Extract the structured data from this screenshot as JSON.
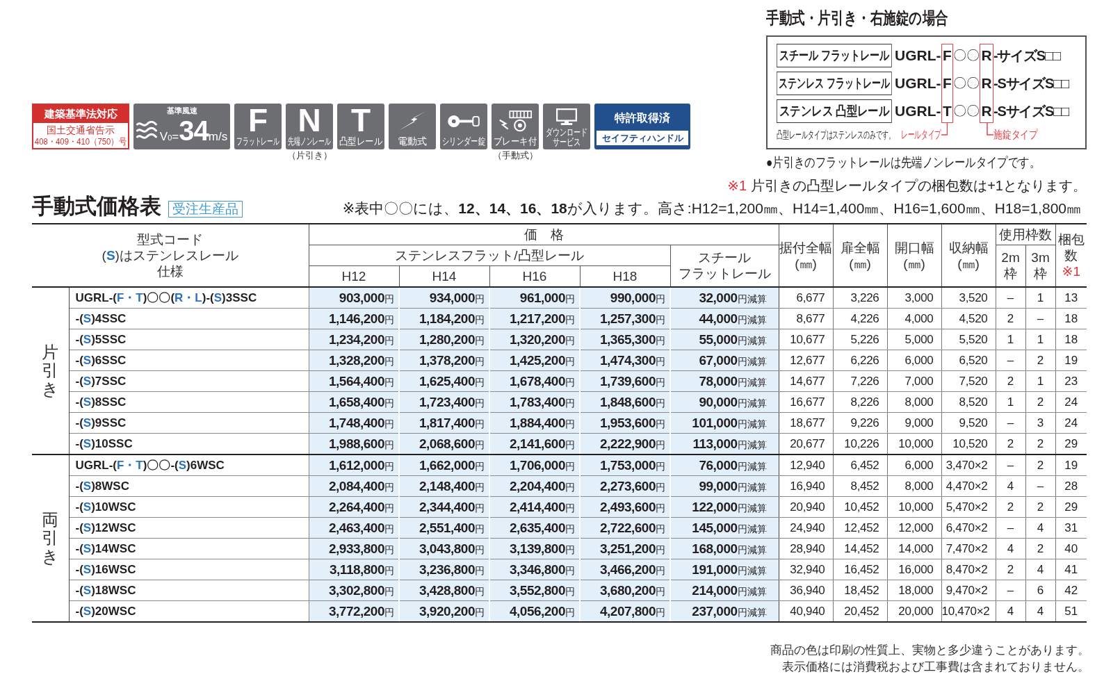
{
  "badges": [
    {
      "kind": "certification",
      "title": "建築基準法対応",
      "lines": [
        "国土交通省告示",
        "408・409・410（750）号"
      ]
    },
    {
      "kind": "wind",
      "caption": "基準風速",
      "speed": "V$_{0}$=**34**m/s"
    },
    {
      "kind": "letter",
      "letter": "F",
      "label": "フラットレール"
    },
    {
      "kind": "letter",
      "letter": "N",
      "label": "先端ノンレール",
      "note": "（片引き）"
    },
    {
      "kind": "letter",
      "letter": "T",
      "label": "凸型レール"
    },
    {
      "kind": "electric",
      "label": "電動式"
    },
    {
      "kind": "lock",
      "label": "シリンダー錠"
    },
    {
      "kind": "brake",
      "label": "ブレーキ付",
      "note": "（手動式）"
    },
    {
      "kind": "download",
      "label": "ダウンロードサービス"
    },
    {
      "kind": "patent",
      "title": "特許取得済",
      "subtitle": "セイフティハンドル"
    }
  ],
  "code_guide": {
    "title": "手動式・片引き・右施錠の場合",
    "rows": [
      {
        "label": "スチール フラットレール",
        "prefix": "UGRL-",
        "rail": "F",
        "size": "〇〇",
        "lock": "R",
        "suffix": "-サイズS□□"
      },
      {
        "label": "ステンレス フラットレール",
        "prefix": "UGRL-",
        "rail": "F",
        "size": "〇〇",
        "lock": "R",
        "suffix": "-SサイズS□□"
      },
      {
        "label": "ステンレス 凸型レール",
        "prefix": "UGRL-",
        "rail": "T",
        "size": "〇〇",
        "lock": "R",
        "suffix": "-SサイズS□□"
      }
    ],
    "note": "凸型レールタイプはステンレスのみです。",
    "rail_marker": "レールタイプ",
    "lock_marker": "施錠タイプ",
    "bullet": "●片引きのフラットレールは先端ノンレールタイプです。"
  },
  "package_note": {
    "mark": "※1",
    "text": "片引きの凸型レールタイプの梱包数は+1となります。"
  },
  "heading": {
    "title": "手動式価格表",
    "tag": "受注生産品",
    "note": "※表中〇〇には、**12、14、16、18**が入ります。高さ:H12=1,200㎜、H14=1,400㎜、H16=1,600㎜、H18=1,800㎜"
  },
  "table": {
    "code_header": [
      [
        {
          "text": "型式コード",
          "emphasis": false
        }
      ],
      [
        {
          "text": "(",
          "emphasis": false
        },
        {
          "text": "S",
          "emphasis": true
        },
        {
          "text": ")はステンレスレール",
          "emphasis": false
        }
      ],
      [
        {
          "text": "仕様",
          "emphasis": false
        }
      ]
    ],
    "price_header": "価　格",
    "stainless_header": "ステンレスフラット/凸型レール",
    "height_headers": [
      "H12",
      "H14",
      "H16",
      "H18"
    ],
    "steel_header": [
      "スチール",
      "フラットレール"
    ],
    "size_headers": [
      "据付全幅(㎜)",
      "扉全幅(㎜)",
      "開口幅(㎜)",
      "収納幅(㎜)"
    ],
    "frames_header": "使用枠数",
    "frame_headers": [
      "2m枠",
      "3m枠"
    ],
    "packages_header": {
      "label": "梱包数",
      "note": "※1"
    },
    "groups": [
      {
        "label": "片引き",
        "rows": [
          {
            "code": [
              {
                "text": "UGRL-(",
                "emphasis": false
              },
              {
                "text": "F・T",
                "emphasis": true
              },
              {
                "text": ")〇〇(",
                "emphasis": false
              },
              {
                "text": "R・L",
                "emphasis": true
              },
              {
                "text": ")-(",
                "emphasis": false
              },
              {
                "text": "S",
                "emphasis": true
              },
              {
                "text": ")3SSC",
                "emphasis": false
              }
            ],
            "prices": [
              "903,000円",
              "934,000円",
              "961,000円",
              "990,000円"
            ],
            "steel": "32,000円減算",
            "sizes": [
              "6,677",
              "3,226",
              "3,000",
              "3,520"
            ],
            "frames": [
              "–",
              "1"
            ],
            "packages": "13"
          },
          {
            "code": [
              {
                "text": "-(",
                "emphasis": false
              },
              {
                "text": "S",
                "emphasis": true
              },
              {
                "text": ")4SSC",
                "emphasis": false
              }
            ],
            "prices": [
              "1,146,200円",
              "1,184,200円",
              "1,217,200円",
              "1,257,300円"
            ],
            "steel": "44,000円減算",
            "sizes": [
              "8,677",
              "4,226",
              "4,000",
              "4,520"
            ],
            "frames": [
              "2",
              "–"
            ],
            "packages": "18"
          },
          {
            "code": [
              {
                "text": "-(",
                "emphasis": false
              },
              {
                "text": "S",
                "emphasis": true
              },
              {
                "text": ")5SSC",
                "emphasis": false
              }
            ],
            "prices": [
              "1,234,200円",
              "1,280,200円",
              "1,320,200円",
              "1,365,300円"
            ],
            "steel": "55,000円減算",
            "sizes": [
              "10,677",
              "5,226",
              "5,000",
              "5,520"
            ],
            "frames": [
              "1",
              "1"
            ],
            "packages": "18"
          },
          {
            "code": [
              {
                "text": "-(",
                "emphasis": false
              },
              {
                "text": "S",
                "emphasis": true
              },
              {
                "text": ")6SSC",
                "emphasis": false
              }
            ],
            "prices": [
              "1,328,200円",
              "1,378,200円",
              "1,425,200円",
              "1,474,300円"
            ],
            "steel": "67,000円減算",
            "sizes": [
              "12,677",
              "6,226",
              "6,000",
              "6,520"
            ],
            "frames": [
              "–",
              "2"
            ],
            "packages": "19"
          },
          {
            "code": [
              {
                "text": "-(",
                "emphasis": false
              },
              {
                "text": "S",
                "emphasis": true
              },
              {
                "text": ")7SSC",
                "emphasis": false
              }
            ],
            "prices": [
              "1,564,400円",
              "1,625,400円",
              "1,678,400円",
              "1,739,600円"
            ],
            "steel": "78,000円減算",
            "sizes": [
              "14,677",
              "7,226",
              "7,000",
              "7,520"
            ],
            "frames": [
              "2",
              "1"
            ],
            "packages": "23"
          },
          {
            "code": [
              {
                "text": "-(",
                "emphasis": false
              },
              {
                "text": "S",
                "emphasis": true
              },
              {
                "text": ")8SSC",
                "emphasis": false
              }
            ],
            "prices": [
              "1,658,400円",
              "1,723,400円",
              "1,783,400円",
              "1,848,600円"
            ],
            "steel": "90,000円減算",
            "sizes": [
              "16,677",
              "8,226",
              "8,000",
              "8,520"
            ],
            "frames": [
              "1",
              "2"
            ],
            "packages": "24"
          },
          {
            "code": [
              {
                "text": "-(",
                "emphasis": false
              },
              {
                "text": "S",
                "emphasis": true
              },
              {
                "text": ")9SSC",
                "emphasis": false
              }
            ],
            "prices": [
              "1,748,400円",
              "1,817,400円",
              "1,884,400円",
              "1,953,600円"
            ],
            "steel": "101,000円減算",
            "sizes": [
              "18,677",
              "9,226",
              "9,000",
              "9,520"
            ],
            "frames": [
              "–",
              "3"
            ],
            "packages": "24"
          },
          {
            "code": [
              {
                "text": "-(",
                "emphasis": false
              },
              {
                "text": "S",
                "emphasis": true
              },
              {
                "text": ")10SSC",
                "emphasis": false
              }
            ],
            "prices": [
              "1,988,600円",
              "2,068,600円",
              "2,141,600円",
              "2,222,900円"
            ],
            "steel": "113,000円減算",
            "sizes": [
              "20,677",
              "10,226",
              "10,000",
              "10,520"
            ],
            "frames": [
              "2",
              "2"
            ],
            "packages": "29"
          }
        ]
      },
      {
        "label": "両引き",
        "rows": [
          {
            "code": [
              {
                "text": "UGRL-(",
                "emphasis": false
              },
              {
                "text": "F・T",
                "emphasis": true
              },
              {
                "text": ")〇〇-(",
                "emphasis": false
              },
              {
                "text": "S",
                "emphasis": true
              },
              {
                "text": ")6WSC",
                "emphasis": false
              }
            ],
            "prices": [
              "1,612,000円",
              "1,662,000円",
              "1,706,000円",
              "1,753,000円"
            ],
            "steel": "76,000円減算",
            "sizes": [
              "12,940",
              "6,452",
              "6,000",
              "3,470×2"
            ],
            "frames": [
              "–",
              "2"
            ],
            "packages": "19"
          },
          {
            "code": [
              {
                "text": "-(",
                "emphasis": false
              },
              {
                "text": "S",
                "emphasis": true
              },
              {
                "text": ")8WSC",
                "emphasis": false
              }
            ],
            "prices": [
              "2,084,400円",
              "2,148,400円",
              "2,204,400円",
              "2,273,600円"
            ],
            "steel": "99,000円減算",
            "sizes": [
              "16,940",
              "8,452",
              "8,000",
              "4,470×2"
            ],
            "frames": [
              "4",
              "–"
            ],
            "packages": "28"
          },
          {
            "code": [
              {
                "text": "-(",
                "emphasis": false
              },
              {
                "text": "S",
                "emphasis": true
              },
              {
                "text": ")10WSC",
                "emphasis": false
              }
            ],
            "prices": [
              "2,264,400円",
              "2,344,400円",
              "2,414,400円",
              "2,493,600円"
            ],
            "steel": "122,000円減算",
            "sizes": [
              "20,940",
              "10,452",
              "10,000",
              "5,470×2"
            ],
            "frames": [
              "2",
              "2"
            ],
            "packages": "29"
          },
          {
            "code": [
              {
                "text": "-(",
                "emphasis": false
              },
              {
                "text": "S",
                "emphasis": true
              },
              {
                "text": ")12WSC",
                "emphasis": false
              }
            ],
            "prices": [
              "2,463,400円",
              "2,551,400円",
              "2,635,400円",
              "2,722,600円"
            ],
            "steel": "145,000円減算",
            "sizes": [
              "24,940",
              "12,452",
              "12,000",
              "6,470×2"
            ],
            "frames": [
              "–",
              "4"
            ],
            "packages": "31"
          },
          {
            "code": [
              {
                "text": "-(",
                "emphasis": false
              },
              {
                "text": "S",
                "emphasis": true
              },
              {
                "text": ")14WSC",
                "emphasis": false
              }
            ],
            "prices": [
              "2,933,800円",
              "3,043,800円",
              "3,139,800円",
              "3,251,200円"
            ],
            "steel": "168,000円減算",
            "sizes": [
              "28,940",
              "14,452",
              "14,000",
              "7,470×2"
            ],
            "frames": [
              "4",
              "2"
            ],
            "packages": "40"
          },
          {
            "code": [
              {
                "text": "-(",
                "emphasis": false
              },
              {
                "text": "S",
                "emphasis": true
              },
              {
                "text": ")16WSC",
                "emphasis": false
              }
            ],
            "prices": [
              "3,118,800円",
              "3,236,800円",
              "3,346,800円",
              "3,466,200円"
            ],
            "steel": "191,000円減算",
            "sizes": [
              "32,940",
              "16,452",
              "16,000",
              "8,470×2"
            ],
            "frames": [
              "2",
              "4"
            ],
            "packages": "41"
          },
          {
            "code": [
              {
                "text": "-(",
                "emphasis": false
              },
              {
                "text": "S",
                "emphasis": true
              },
              {
                "text": ")18WSC",
                "emphasis": false
              }
            ],
            "prices": [
              "3,302,800円",
              "3,428,800円",
              "3,552,800円",
              "3,680,200円"
            ],
            "steel": "214,000円減算",
            "sizes": [
              "36,940",
              "18,452",
              "18,000",
              "9,470×2"
            ],
            "frames": [
              "–",
              "6"
            ],
            "packages": "42"
          },
          {
            "code": [
              {
                "text": "-(",
                "emphasis": false
              },
              {
                "text": "S",
                "emphasis": true
              },
              {
                "text": ")20WSC",
                "emphasis": false
              }
            ],
            "prices": [
              "3,772,200円",
              "3,920,200円",
              "4,056,200円",
              "4,207,800円"
            ],
            "steel": "237,000円減算",
            "sizes": [
              "40,940",
              "20,452",
              "20,000",
              "10,470×2"
            ],
            "frames": [
              "4",
              "4"
            ],
            "packages": "51"
          }
        ]
      }
    ]
  },
  "footer": [
    "商品の色は印刷の性質上、実物と多少違うことがあります。",
    "表示価格には消費税および工事費は含まれておりません。"
  ]
}
